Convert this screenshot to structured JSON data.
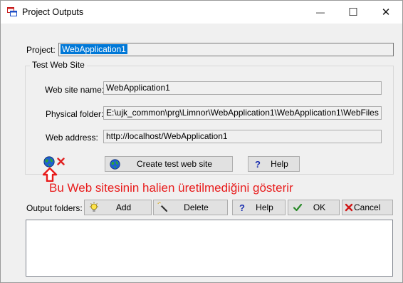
{
  "window": {
    "title": "Project Outputs",
    "minimize_glyph": "—",
    "maximize_glyph": "☐",
    "close_glyph": "✕"
  },
  "project": {
    "label": "Project:",
    "value": "WebApplication1"
  },
  "test_web_site": {
    "group_title": "Test Web Site",
    "site_name_label": "Web site name:",
    "site_name_value": "WebApplication1",
    "physical_folder_label": "Physical folder:",
    "physical_folder_value": "E:\\ujk_common\\prg\\Limnor\\WebApplication1\\WebApplication1\\WebFiles",
    "web_address_label": "Web address:",
    "web_address_value": "http://localhost/WebApplication1",
    "create_button": "Create test web site",
    "help_button": "Help"
  },
  "annotation": {
    "note": "Bu Web sitesinin halien üretilmediğini gösterir"
  },
  "output_folders": {
    "label": "Output folders:",
    "add_button": "Add",
    "delete_button": "Delete",
    "help_button": "Help",
    "ok_button": "OK",
    "cancel_button": "Cancel"
  },
  "icons": {
    "globe": "globe-icon",
    "red_x": "red-x-icon",
    "up_arrow": "red-up-arrow-icon",
    "question": "question-mark-icon",
    "bulb": "light-bulb-icon",
    "wand": "magic-wand-icon",
    "check": "check-mark-icon",
    "cancel": "cancel-x-icon"
  },
  "colors": {
    "selection": "#0078d7",
    "annotation_red": "#e81c1c",
    "help_blue": "#1a2fb0"
  }
}
